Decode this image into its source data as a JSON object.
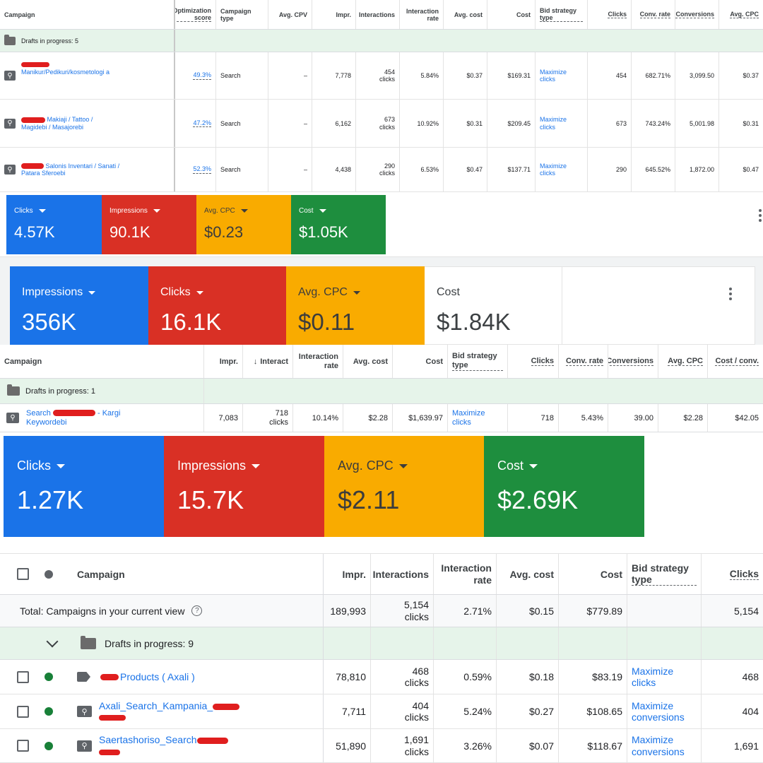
{
  "colors": {
    "blue": "#1a73e8",
    "red": "#d93025",
    "yellow": "#f9ab00",
    "green": "#1e8e3e",
    "draft_bg": "#e6f4ea",
    "redaction": "#e01e1e"
  },
  "icons": [
    "search-icon",
    "folder-icon",
    "chevron-down-icon",
    "help-circle-icon",
    "more-vert-icon",
    "dropdown-caret-icon",
    "tag-icon",
    "search-ad-icon",
    "sort-arrow-down-icon"
  ],
  "table1": {
    "headers": [
      "Campaign",
      "Optimization score",
      "Campaign type",
      "Avg. CPV",
      "Impr.",
      "Interactions",
      "Interaction rate",
      "Avg. cost",
      "Cost",
      "Bid strategy type",
      "Clicks",
      "Conv. rate",
      "Conversions",
      "Avg. CPC"
    ],
    "draft_label": "Drafts in progress: 5",
    "rows": [
      {
        "campaign": "Manikur/Pedikuri/kosmetologi a",
        "opt_score": "49.3%",
        "type": "Search",
        "cpv": "–",
        "impr": "7,778",
        "inter_num": "454",
        "inter_unit": "clicks",
        "rate": "5.84%",
        "avg_cost": "$0.37",
        "cost": "$169.31",
        "bid1": "Maximize",
        "bid2": "clicks",
        "clicks": "454",
        "conv_rate": "682.71%",
        "conversions": "3,099.50",
        "cpc": "$0.37"
      },
      {
        "campaign": "Makiaji / Tattoo / Magidebi / Masajorebi",
        "opt_score": "47.2%",
        "type": "Search",
        "cpv": "–",
        "impr": "6,162",
        "inter_num": "673",
        "inter_unit": "clicks",
        "rate": "10.92%",
        "avg_cost": "$0.31",
        "cost": "$209.45",
        "bid1": "Maximize",
        "bid2": "clicks",
        "clicks": "673",
        "conv_rate": "743.24%",
        "conversions": "5,001.98",
        "cpc": "$0.31"
      },
      {
        "campaign": "Salonis Inventari / Sanati / Patara Sferoebi",
        "opt_score": "52.3%",
        "type": "Search",
        "cpv": "–",
        "impr": "4,438",
        "inter_num": "290",
        "inter_unit": "clicks",
        "rate": "6.53%",
        "avg_cost": "$0.47",
        "cost": "$137.71",
        "bid1": "Maximize",
        "bid2": "clicks",
        "clicks": "290",
        "conv_rate": "645.52%",
        "conversions": "1,872.00",
        "cpc": "$0.47"
      }
    ]
  },
  "metrics1": [
    {
      "label": "Clicks",
      "value": "4.57K"
    },
    {
      "label": "Impressions",
      "value": "90.1K"
    },
    {
      "label": "Avg. CPC",
      "value": "$0.23"
    },
    {
      "label": "Cost",
      "value": "$1.05K"
    }
  ],
  "metrics2": [
    {
      "label": "Impressions",
      "value": "356K"
    },
    {
      "label": "Clicks",
      "value": "16.1K"
    },
    {
      "label": "Avg. CPC",
      "value": "$0.11"
    },
    {
      "label": "Cost",
      "value": "$1.84K"
    }
  ],
  "table2": {
    "headers": [
      "Campaign",
      "Impr.",
      "Interact",
      "Interaction rate",
      "Avg. cost",
      "Cost",
      "Bid strategy type",
      "Clicks",
      "Conv. rate",
      "Conversions",
      "Avg. CPC",
      "Cost / conv."
    ],
    "draft_label": "Drafts in progress: 1",
    "row": {
      "campaign_a": "Search",
      "campaign_b": "- Kargi",
      "campaign_c": "Keywordebi",
      "impr": "7,083",
      "inter_num": "718",
      "inter_unit": "clicks",
      "rate": "10.14%",
      "avg_cost": "$2.28",
      "cost": "$1,639.97",
      "bid1": "Maximize",
      "bid2": "clicks",
      "clicks": "718",
      "conv_rate": "5.43%",
      "conversions": "39.00",
      "cpc": "$2.28",
      "cost_conv": "$42.05"
    }
  },
  "metrics3": [
    {
      "label": "Clicks",
      "value": "1.27K"
    },
    {
      "label": "Impressions",
      "value": "15.7K"
    },
    {
      "label": "Avg. CPC",
      "value": "$2.11"
    },
    {
      "label": "Cost",
      "value": "$2.69K"
    }
  ],
  "table3": {
    "headers": [
      "Campaign",
      "Impr.",
      "Interactions",
      "Interaction rate",
      "Avg. cost",
      "Cost",
      "Bid strategy type",
      "Clicks"
    ],
    "total": {
      "label": "Total: Campaigns in your current view",
      "impr": "189,993",
      "inter_num": "5,154",
      "inter_unit": "clicks",
      "rate": "2.71%",
      "avg_cost": "$0.15",
      "cost": "$779.89",
      "clicks": "5,154"
    },
    "draft_label": "Drafts in progress: 9",
    "rows": [
      {
        "campaign": "Products ( Axali )",
        "impr": "78,810",
        "inter_num": "468",
        "inter_unit": "clicks",
        "rate": "0.59%",
        "avg_cost": "$0.18",
        "cost": "$83.19",
        "bid1": "Maximize",
        "bid2": "clicks",
        "clicks": "468"
      },
      {
        "campaign": "Axali_Search_Kampania_",
        "impr": "7,711",
        "inter_num": "404",
        "inter_unit": "clicks",
        "rate": "5.24%",
        "avg_cost": "$0.27",
        "cost": "$108.65",
        "bid1": "Maximize",
        "bid2": "conversions",
        "clicks": "404"
      },
      {
        "campaign": "Saertashoriso_Search",
        "impr": "51,890",
        "inter_num": "1,691",
        "inter_unit": "clicks",
        "rate": "3.26%",
        "avg_cost": "$0.07",
        "cost": "$118.67",
        "bid1": "Maximize",
        "bid2": "conversions",
        "clicks": "1,691"
      }
    ]
  }
}
